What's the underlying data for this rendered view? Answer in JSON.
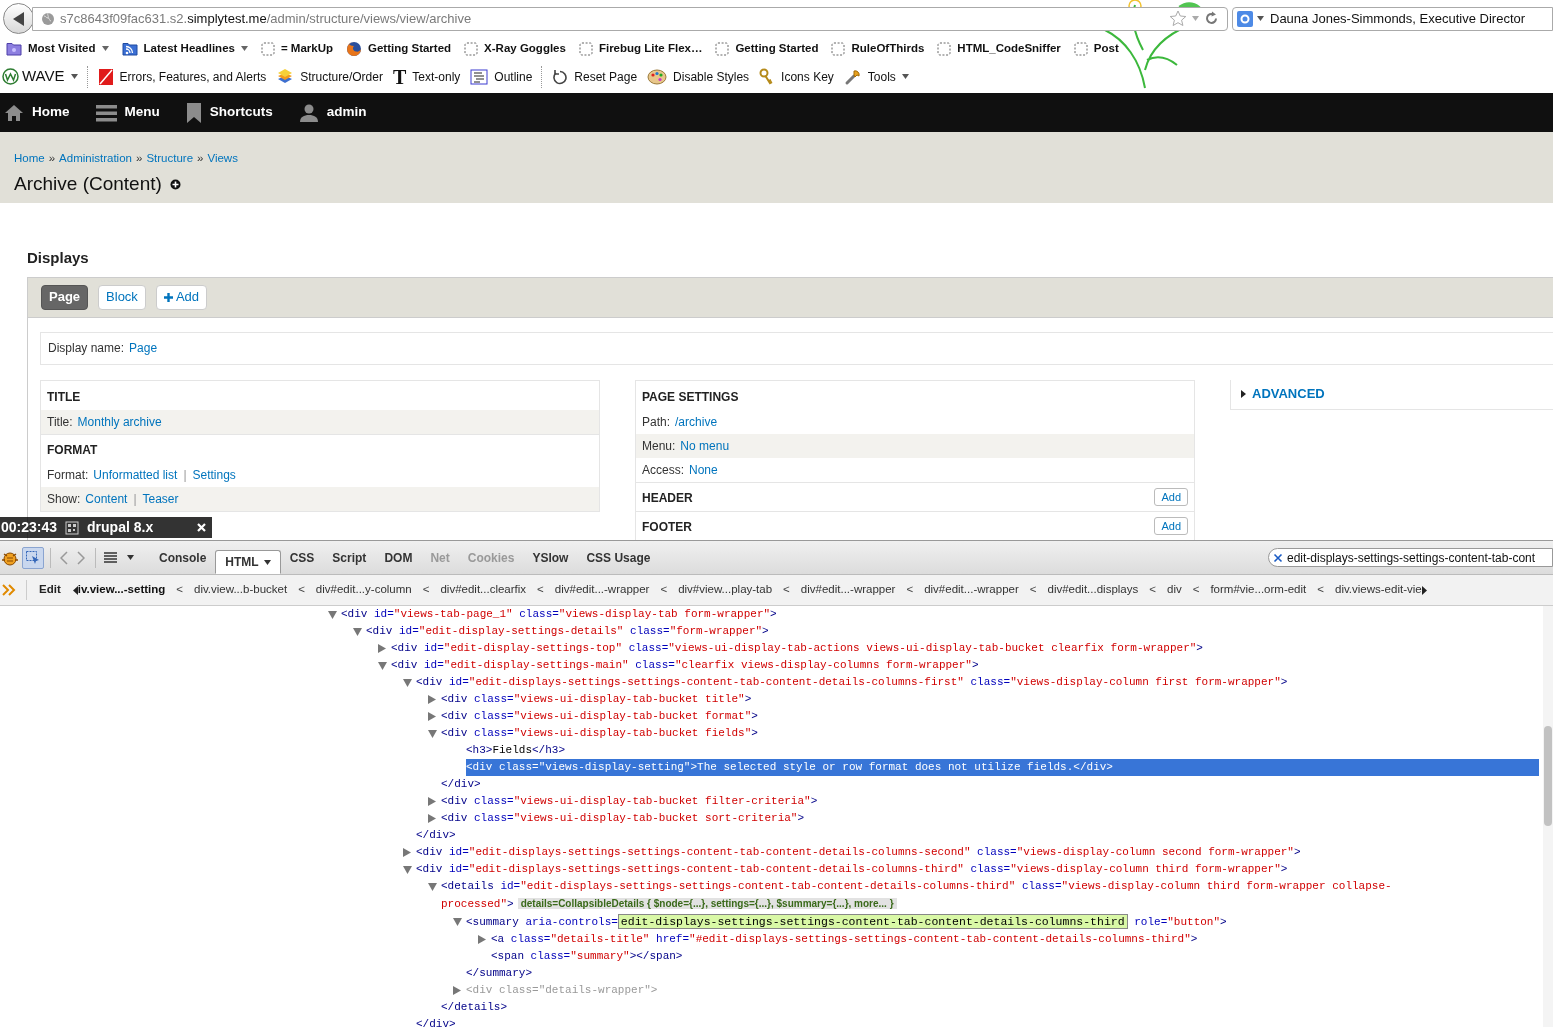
{
  "address_bar": {
    "url_parts": [
      {
        "text": "s7c8643f09fac631.s2.",
        "highlight": false
      },
      {
        "text": "simplytest.me",
        "highlight": true
      },
      {
        "text": "/admin/structure/views/view/archive",
        "highlight": false
      }
    ]
  },
  "search_box": {
    "value": "Dauna Jones-Simmonds, Executive Director"
  },
  "bookmarks": [
    {
      "label": "Most Visited",
      "dropdown": true
    },
    {
      "label": "Latest Headlines",
      "dropdown": true
    },
    {
      "label": "= MarkUp",
      "dropdown": false
    },
    {
      "label": "Getting Started",
      "dropdown": false
    },
    {
      "label": "X-Ray Goggles",
      "dropdown": false
    },
    {
      "label": "Firebug Lite Flex…",
      "dropdown": false
    },
    {
      "label": "Getting Started",
      "dropdown": false
    },
    {
      "label": "RuleOfThirds",
      "dropdown": false
    },
    {
      "label": "HTML_CodeSniffer",
      "dropdown": false
    },
    {
      "label": "Post",
      "dropdown": false
    }
  ],
  "wave_toolbar": [
    {
      "label": "WAVE",
      "dropdown": true,
      "separator_after": true
    },
    {
      "label": "Errors, Features, and Alerts",
      "dropdown": false,
      "separator_after": false
    },
    {
      "label": "Structure/Order",
      "dropdown": false,
      "separator_after": false
    },
    {
      "label": "Text-only",
      "glyph": "T",
      "dropdown": false,
      "separator_after": false
    },
    {
      "label": "Outline",
      "dropdown": false,
      "separator_after": true
    },
    {
      "label": "Reset Page",
      "dropdown": false,
      "separator_after": false
    },
    {
      "label": "Disable Styles",
      "dropdown": false,
      "separator_after": false
    },
    {
      "label": "Icons Key",
      "dropdown": false,
      "separator_after": false
    },
    {
      "label": "Tools",
      "dropdown": true,
      "separator_after": false
    }
  ],
  "admin_toolbar": [
    {
      "label": "Home"
    },
    {
      "label": "Menu"
    },
    {
      "label": "Shortcuts"
    },
    {
      "label": "admin"
    }
  ],
  "breadcrumb": [
    {
      "text": "Home"
    },
    {
      "sep": "»",
      "text": "Administration"
    },
    {
      "sep": "»",
      "text": "Structure"
    },
    {
      "sep": "»",
      "text": "Views"
    }
  ],
  "page_title": "Archive (Content)",
  "displays": {
    "heading": "Displays",
    "tabs": [
      {
        "kind": "display",
        "label": "Page",
        "selected": true
      },
      {
        "kind": "display",
        "label": "Block",
        "selected": false
      },
      {
        "kind": "add",
        "label": "Add",
        "selected": false
      }
    ],
    "display_name": {
      "label": "Display name:",
      "value": "Page"
    },
    "columns": [
      {
        "sections": [
          {
            "heading": "TITLE",
            "rows": [
              {
                "label": "Title:",
                "shaded": true,
                "links": [
                  {
                    "text": "Monthly archive"
                  }
                ]
              }
            ]
          },
          {
            "heading": "FORMAT",
            "rows": [
              {
                "label": "Format:",
                "shaded": false,
                "links": [
                  {
                    "text": "Unformatted list"
                  },
                  {
                    "sep": "|",
                    "text": "Settings"
                  }
                ]
              },
              {
                "label": "Show:",
                "shaded": true,
                "links": [
                  {
                    "text": "Content"
                  },
                  {
                    "sep": "|",
                    "text": "Teaser"
                  }
                ]
              }
            ]
          }
        ]
      },
      {
        "sections": [
          {
            "heading": "PAGE SETTINGS",
            "rows": [
              {
                "label": "Path:",
                "shaded": false,
                "links": [
                  {
                    "text": "/archive"
                  }
                ]
              },
              {
                "label": "Menu:",
                "shaded": true,
                "links": [
                  {
                    "text": "No menu"
                  }
                ]
              },
              {
                "label": "Access:",
                "shaded": false,
                "links": [
                  {
                    "text": "None"
                  }
                ]
              }
            ]
          },
          {
            "heading": "HEADER",
            "button": "Add"
          },
          {
            "heading": "FOOTER",
            "button": "Add"
          }
        ]
      }
    ],
    "advanced": "ADVANCED"
  },
  "recorder_overlay": {
    "time": "00:23:43",
    "title": "drupal 8.x"
  },
  "firebug": {
    "tabs": [
      {
        "label": "Console",
        "selected": false,
        "disabled": false,
        "dropdown": false
      },
      {
        "label": "HTML",
        "selected": true,
        "disabled": false,
        "dropdown": true
      },
      {
        "label": "CSS",
        "selected": false,
        "disabled": false,
        "dropdown": false
      },
      {
        "label": "Script",
        "selected": false,
        "disabled": false,
        "dropdown": false
      },
      {
        "label": "DOM",
        "selected": false,
        "disabled": false,
        "dropdown": false
      },
      {
        "label": "Net",
        "selected": false,
        "disabled": true,
        "dropdown": false
      },
      {
        "label": "Cookies",
        "selected": false,
        "disabled": true,
        "dropdown": false
      },
      {
        "label": "YSlow",
        "selected": false,
        "disabled": false,
        "dropdown": false
      },
      {
        "label": "CSS Usage",
        "selected": false,
        "disabled": false,
        "dropdown": false
      }
    ],
    "search": "edit-displays-settings-settings-content-tab-cont",
    "edit_button": "Edit",
    "path": [
      {
        "text": "iv.view...-setting",
        "selected": true
      },
      {
        "sep": "<",
        "text": "div.view...b-bucket",
        "selected": false
      },
      {
        "sep": "<",
        "text": "div#edit...y-column",
        "selected": false
      },
      {
        "sep": "<",
        "text": "div#edit...clearfix",
        "selected": false
      },
      {
        "sep": "<",
        "text": "div#edit...-wrapper",
        "selected": false
      },
      {
        "sep": "<",
        "text": "div#view...play-tab",
        "selected": false
      },
      {
        "sep": "<",
        "text": "div#edit...-wrapper",
        "selected": false
      },
      {
        "sep": "<",
        "text": "div#edit...-wrapper",
        "selected": false
      },
      {
        "sep": "<",
        "text": "div#edit...displays",
        "selected": false
      },
      {
        "sep": "<",
        "text": "div",
        "selected": false
      },
      {
        "sep": "<",
        "text": "form#vie...orm-edit",
        "selected": false
      },
      {
        "sep": "<",
        "text": "div.views-edit-vie",
        "selected": false
      }
    ],
    "tree": [
      {
        "kind": "node",
        "expanded": true,
        "selected": false,
        "dim": false,
        "open": [
          {
            "kind": "tag",
            "text": "<div"
          },
          {
            "kind": "attr",
            "text": " id="
          },
          {
            "kind": "val",
            "text": "\"views-tab-page_1\""
          },
          {
            "kind": "attr",
            "text": " class="
          },
          {
            "kind": "val",
            "text": "\"views-display-tab form-wrapper\""
          },
          {
            "kind": "tag",
            "text": ">"
          }
        ],
        "children": [
          {
            "kind": "node",
            "expanded": true,
            "selected": false,
            "dim": false,
            "open": [
              {
                "kind": "tag",
                "text": "<div"
              },
              {
                "kind": "attr",
                "text": " id="
              },
              {
                "kind": "val",
                "text": "\"edit-display-settings-details\""
              },
              {
                "kind": "attr",
                "text": " class="
              },
              {
                "kind": "val",
                "text": "\"form-wrapper\""
              },
              {
                "kind": "tag",
                "text": ">"
              }
            ],
            "children": [
              {
                "kind": "node",
                "expanded": false,
                "selected": false,
                "dim": false,
                "open": [
                  {
                    "kind": "tag",
                    "text": "<div"
                  },
                  {
                    "kind": "attr",
                    "text": " id="
                  },
                  {
                    "kind": "val",
                    "text": "\"edit-display-settings-top\""
                  },
                  {
                    "kind": "attr",
                    "text": " class="
                  },
                  {
                    "kind": "val",
                    "text": "\"views-ui-display-tab-actions views-ui-display-tab-bucket clearfix form-wrapper\""
                  },
                  {
                    "kind": "tag",
                    "text": ">"
                  }
                ]
              },
              {
                "kind": "node",
                "expanded": true,
                "selected": false,
                "dim": false,
                "open": [
                  {
                    "kind": "tag",
                    "text": "<div"
                  },
                  {
                    "kind": "attr",
                    "text": " id="
                  },
                  {
                    "kind": "val",
                    "text": "\"edit-display-settings-main\""
                  },
                  {
                    "kind": "attr",
                    "text": " class="
                  },
                  {
                    "kind": "val",
                    "text": "\"clearfix views-display-columns form-wrapper\""
                  },
                  {
                    "kind": "tag",
                    "text": ">"
                  }
                ],
                "children": [
                  {
                    "kind": "node",
                    "expanded": true,
                    "selected": false,
                    "dim": false,
                    "open": [
                      {
                        "kind": "tag",
                        "text": "<div"
                      },
                      {
                        "kind": "attr",
                        "text": " id="
                      },
                      {
                        "kind": "val",
                        "text": "\"edit-displays-settings-settings-content-tab-content-details-columns-first\""
                      },
                      {
                        "kind": "attr",
                        "text": " class="
                      },
                      {
                        "kind": "val",
                        "text": "\"views-display-column first form-wrapper\""
                      },
                      {
                        "kind": "tag",
                        "text": ">"
                      }
                    ],
                    "children": [
                      {
                        "kind": "node",
                        "expanded": false,
                        "selected": false,
                        "dim": false,
                        "open": [
                          {
                            "kind": "tag",
                            "text": "<div"
                          },
                          {
                            "kind": "attr",
                            "text": " class="
                          },
                          {
                            "kind": "val",
                            "text": "\"views-ui-display-tab-bucket title\""
                          },
                          {
                            "kind": "tag",
                            "text": ">"
                          }
                        ]
                      },
                      {
                        "kind": "node",
                        "expanded": false,
                        "selected": false,
                        "dim": false,
                        "open": [
                          {
                            "kind": "tag",
                            "text": "<div"
                          },
                          {
                            "kind": "attr",
                            "text": " class="
                          },
                          {
                            "kind": "val",
                            "text": "\"views-ui-display-tab-bucket format\""
                          },
                          {
                            "kind": "tag",
                            "text": ">"
                          }
                        ]
                      },
                      {
                        "kind": "node",
                        "expanded": true,
                        "selected": false,
                        "dim": false,
                        "open": [
                          {
                            "kind": "tag",
                            "text": "<div"
                          },
                          {
                            "kind": "attr",
                            "text": " class="
                          },
                          {
                            "kind": "val",
                            "text": "\"views-ui-display-tab-bucket fields\""
                          },
                          {
                            "kind": "tag",
                            "text": ">"
                          }
                        ],
                        "children": [
                          {
                            "kind": "leaf",
                            "selected": false,
                            "dim": false,
                            "open": [
                              {
                                "kind": "tag",
                                "text": "<h3>"
                              },
                              {
                                "kind": "txt",
                                "text": "Fields"
                              },
                              {
                                "kind": "tag",
                                "text": "</h3>"
                              }
                            ]
                          },
                          {
                            "kind": "leaf",
                            "selected": true,
                            "dim": false,
                            "open": [
                              {
                                "kind": "tag",
                                "text": "<div"
                              },
                              {
                                "kind": "attr",
                                "text": " class="
                              },
                              {
                                "kind": "val",
                                "text": "\"views-display-setting\""
                              },
                              {
                                "kind": "tag",
                                "text": ">"
                              },
                              {
                                "kind": "txt",
                                "text": "The selected style or row format does not utilize fields."
                              },
                              {
                                "kind": "tag",
                                "text": "</div>"
                              }
                            ]
                          }
                        ],
                        "close": [
                          {
                            "kind": "tag",
                            "text": "</div>"
                          }
                        ]
                      },
                      {
                        "kind": "node",
                        "expanded": false,
                        "selected": false,
                        "dim": false,
                        "open": [
                          {
                            "kind": "tag",
                            "text": "<div"
                          },
                          {
                            "kind": "attr",
                            "text": " class="
                          },
                          {
                            "kind": "val",
                            "text": "\"views-ui-display-tab-bucket filter-criteria\""
                          },
                          {
                            "kind": "tag",
                            "text": ">"
                          }
                        ]
                      },
                      {
                        "kind": "node",
                        "expanded": false,
                        "selected": false,
                        "dim": false,
                        "open": [
                          {
                            "kind": "tag",
                            "text": "<div"
                          },
                          {
                            "kind": "attr",
                            "text": " class="
                          },
                          {
                            "kind": "val",
                            "text": "\"views-ui-display-tab-bucket sort-criteria\""
                          },
                          {
                            "kind": "tag",
                            "text": ">"
                          }
                        ]
                      }
                    ],
                    "close": [
                      {
                        "kind": "tag",
                        "text": "</div>"
                      }
                    ]
                  },
                  {
                    "kind": "node",
                    "expanded": false,
                    "selected": false,
                    "dim": false,
                    "open": [
                      {
                        "kind": "tag",
                        "text": "<div"
                      },
                      {
                        "kind": "attr",
                        "text": " id="
                      },
                      {
                        "kind": "val",
                        "text": "\"edit-displays-settings-settings-content-tab-content-details-columns-second\""
                      },
                      {
                        "kind": "attr",
                        "text": " class="
                      },
                      {
                        "kind": "val",
                        "text": "\"views-display-column second form-wrapper\""
                      },
                      {
                        "kind": "tag",
                        "text": ">"
                      }
                    ]
                  },
                  {
                    "kind": "node",
                    "expanded": true,
                    "selected": false,
                    "dim": false,
                    "open": [
                      {
                        "kind": "tag",
                        "text": "<div"
                      },
                      {
                        "kind": "attr",
                        "text": " id="
                      },
                      {
                        "kind": "val",
                        "text": "\"edit-displays-settings-settings-content-tab-content-details-columns-third\""
                      },
                      {
                        "kind": "attr",
                        "text": " class="
                      },
                      {
                        "kind": "val",
                        "text": "\"views-display-column third form-wrapper\""
                      },
                      {
                        "kind": "tag",
                        "text": ">"
                      }
                    ],
                    "children": [
                      {
                        "kind": "node",
                        "expanded": true,
                        "selected": false,
                        "dim": false,
                        "open": [
                          {
                            "kind": "tag",
                            "text": "<details"
                          },
                          {
                            "kind": "attr",
                            "text": " id="
                          },
                          {
                            "kind": "val",
                            "text": "\"edit-displays-settings-settings-content-tab-content-details-columns-third\""
                          },
                          {
                            "kind": "attr",
                            "text": " class="
                          },
                          {
                            "kind": "val",
                            "text": "\"views-display-column third form-wrapper collapse-"
                          }
                        ],
                        "open_more": [
                          {
                            "kind": "val",
                            "text": "processed\""
                          },
                          {
                            "kind": "tag",
                            "text": ">"
                          },
                          {
                            "kind": "badge",
                            "text": "details=CollapsibleDetails { $node={...}, settings={...}, $summary={...}, more... }"
                          }
                        ],
                        "children": [
                          {
                            "kind": "node",
                            "expanded": true,
                            "selected": false,
                            "dim": false,
                            "open": [
                              {
                                "kind": "tag",
                                "text": "<summary"
                              },
                              {
                                "kind": "attr",
                                "text": " aria-controls="
                              },
                              {
                                "kind": "edit",
                                "text": "edit-displays-settings-settings-content-tab-content-details-columns-third"
                              },
                              {
                                "kind": "attr",
                                "text": " role="
                              },
                              {
                                "kind": "val",
                                "text": "\"button\""
                              },
                              {
                                "kind": "tag",
                                "text": ">"
                              }
                            ],
                            "children": [
                              {
                                "kind": "node",
                                "expanded": false,
                                "selected": false,
                                "dim": false,
                                "open": [
                                  {
                                    "kind": "tag",
                                    "text": "<a"
                                  },
                                  {
                                    "kind": "attr",
                                    "text": " class="
                                  },
                                  {
                                    "kind": "val",
                                    "text": "\"details-title\""
                                  },
                                  {
                                    "kind": "attr",
                                    "text": " href="
                                  },
                                  {
                                    "kind": "val",
                                    "text": "\"#edit-displays-settings-settings-content-tab-content-details-columns-third\""
                                  },
                                  {
                                    "kind": "tag",
                                    "text": ">"
                                  }
                                ]
                              },
                              {
                                "kind": "leaf",
                                "selected": false,
                                "dim": false,
                                "open": [
                                  {
                                    "kind": "tag",
                                    "text": "<span"
                                  },
                                  {
                                    "kind": "attr",
                                    "text": " class="
                                  },
                                  {
                                    "kind": "val",
                                    "text": "\"summary\""
                                  },
                                  {
                                    "kind": "tag",
                                    "text": "></span>"
                                  }
                                ]
                              }
                            ],
                            "close": [
                              {
                                "kind": "tag",
                                "text": "</summary>"
                              }
                            ]
                          },
                          {
                            "kind": "node",
                            "expanded": false,
                            "selected": false,
                            "dim": true,
                            "open": [
                              {
                                "kind": "tag",
                                "text": "<div"
                              },
                              {
                                "kind": "attr",
                                "text": " class="
                              },
                              {
                                "kind": "val",
                                "text": "\"details-wrapper\""
                              },
                              {
                                "kind": "tag",
                                "text": ">"
                              }
                            ]
                          }
                        ],
                        "close": [
                          {
                            "kind": "tag",
                            "text": "</details>"
                          }
                        ]
                      }
                    ],
                    "close": [
                      {
                        "kind": "tag",
                        "text": "</div>"
                      }
                    ]
                  }
                ]
              }
            ]
          }
        ]
      }
    ]
  }
}
